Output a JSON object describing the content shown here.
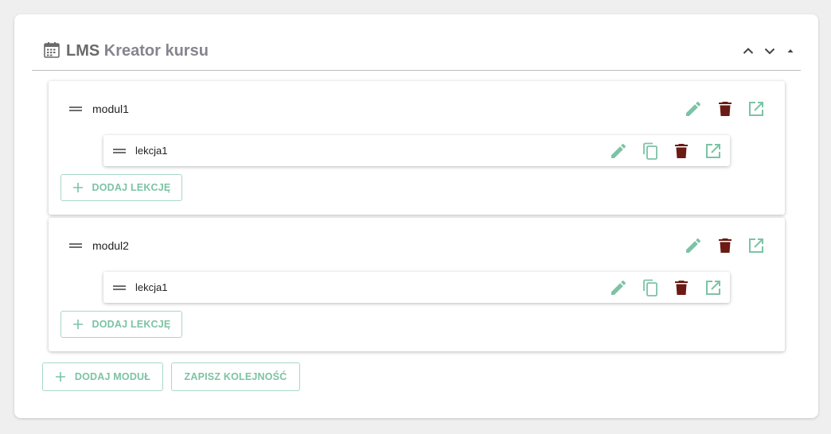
{
  "header": {
    "title_prefix": "LMS",
    "title": "Kreator kursu",
    "icons": [
      "calendar-icon",
      "chevron-up-icon",
      "chevron-down-icon",
      "collapse-triangle-icon"
    ]
  },
  "colors": {
    "accent": "#7cc3a5",
    "delete": "#6b1a14",
    "title_text": "#6a6a6a",
    "title_sub": "#85848f"
  },
  "modules": [
    {
      "name": "modul1",
      "lessons": [
        {
          "name": "lekcja1"
        }
      ],
      "add_lesson_label": "DODAJ LEKCJĘ"
    },
    {
      "name": "modul2",
      "lessons": [
        {
          "name": "lekcja1"
        }
      ],
      "add_lesson_label": "DODAJ LEKCJĘ"
    }
  ],
  "footer": {
    "add_module_label": "DODAJ MODUŁ",
    "save_order_label": "ZAPISZ KOLEJNOŚĆ"
  }
}
